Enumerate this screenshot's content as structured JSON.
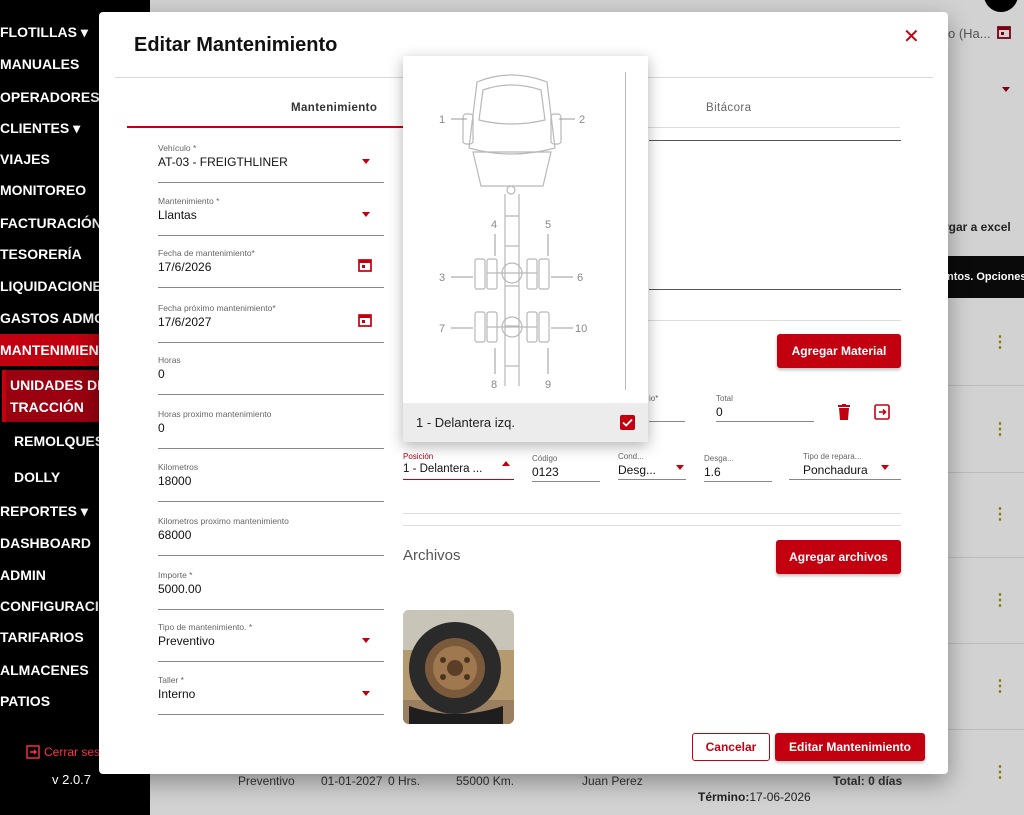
{
  "sidebar": {
    "items": [
      {
        "label": "FLOTILLAS ▾"
      },
      {
        "label": "MANUALES"
      },
      {
        "label": "OPERADORES"
      },
      {
        "label": "CLIENTES ▾"
      },
      {
        "label": "VIAJES"
      },
      {
        "label": "MONITOREO"
      },
      {
        "label": "FACTURACIÓN ▾"
      },
      {
        "label": "TESORERÍA"
      },
      {
        "label": "LIQUIDACIONES"
      },
      {
        "label": "GASTOS ADMON"
      },
      {
        "label": "MANTENIMIENTO"
      }
    ],
    "sub_items": [
      {
        "label": "UNIDADES DE"
      },
      {
        "label": "TRACCIÓN"
      },
      {
        "label": "REMOLQUES"
      },
      {
        "label": "DOLLY"
      }
    ],
    "items_bottom": [
      {
        "label": "REPORTES ▾"
      },
      {
        "label": "DASHBOARD"
      },
      {
        "label": "ADMIN"
      },
      {
        "label": "CONFIGURACIÓN"
      },
      {
        "label": "TARIFARIOS"
      },
      {
        "label": "ALMACENES"
      },
      {
        "label": "PATIOS"
      }
    ],
    "logout": "Cerrar sesión",
    "version": "v 2.0.7"
  },
  "background": {
    "date_input": "o (Ha...",
    "excel": "rgar a excel",
    "table_header": "ntos.  Opciones",
    "bottom_row": {
      "type": "Preventivo",
      "date": "01-01-2027",
      "hours": "0 Hrs.",
      "km": "55000 Km.",
      "person": "Juan Perez",
      "total": "Total: 0 días",
      "end_label": "Término:",
      "end_value": "17-06-2026"
    },
    "dots": "⋮"
  },
  "modal": {
    "title": "Editar Mantenimiento",
    "close": "✕",
    "tabs": [
      {
        "label": "Mantenimiento"
      },
      {
        "label": "Bitácora"
      }
    ],
    "fields": {
      "vehiculo": {
        "label": "Vehículo *",
        "value": "AT-03 - FREIGTHLINER"
      },
      "mantenimiento": {
        "label": "Mantenimiento *",
        "value": "Llantas"
      },
      "fecha": {
        "label": "Fecha de mantenimiento*",
        "value": "17/6/2026"
      },
      "fecha_proximo": {
        "label": "Fecha próximo mantenimiento*",
        "value": "17/6/2027"
      },
      "horas": {
        "label": "Horas",
        "value": "0"
      },
      "horas_proximo": {
        "label": "Horas proximo mantenimiento",
        "value": "0"
      },
      "kilometros": {
        "label": "Kilometros",
        "value": "18000"
      },
      "kilometros_proximo": {
        "label": "Kilometros proximo mantenimiento",
        "value": "68000"
      },
      "importe": {
        "label": "Importe *",
        "value": "5000.00"
      },
      "tipo": {
        "label": "Tipo de mantenimiento. *",
        "value": "Preventivo"
      },
      "taller": {
        "label": "Taller *",
        "value": "Interno"
      }
    },
    "material": {
      "add_button": "Agregar Material",
      "precio_label": "io*",
      "total": {
        "label": "Total",
        "value": "0"
      },
      "posicion": {
        "label": "Posición",
        "value": "1 - Delantera ..."
      },
      "codigo": {
        "label": "Código",
        "value": "0123"
      },
      "condicion": {
        "label": "Cond...",
        "value": "Desg..."
      },
      "desgaste": {
        "label": "Desga...",
        "value": "1.6"
      },
      "tipo_reparacion": {
        "label": "Tipo de repara...",
        "value": "Ponchadura"
      }
    },
    "archivos": {
      "title": "Archivos",
      "add_button": "Agregar archivos"
    },
    "footer": {
      "cancel": "Cancelar",
      "submit": "Editar Mantenimiento"
    }
  },
  "dropdown": {
    "diagram_labels": [
      "1",
      "2",
      "3",
      "4",
      "5",
      "6",
      "7",
      "8",
      "9",
      "10"
    ],
    "option": "1 - Delantera izq."
  },
  "colors": {
    "accent": "#c30010",
    "sidebar_bg": "#000000"
  }
}
